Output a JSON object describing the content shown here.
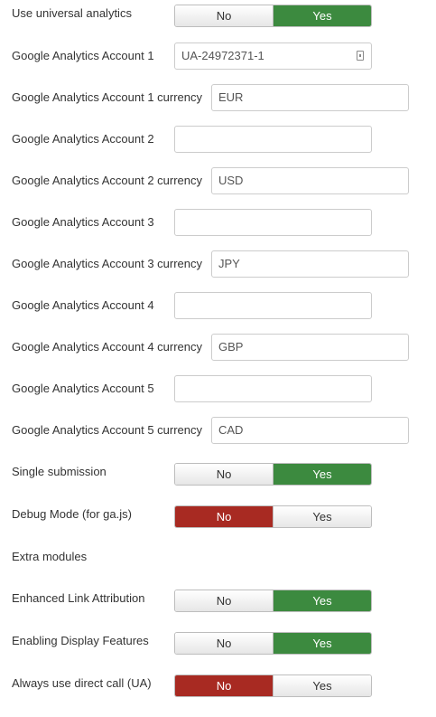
{
  "universal_analytics": {
    "label": "Use universal analytics",
    "no": "No",
    "yes": "Yes",
    "selected": "yes"
  },
  "accounts": [
    {
      "label": "Google Analytics Account 1",
      "value": "UA-24972371-1",
      "currency_label": "Google Analytics Account 1 currency",
      "currency": "EUR"
    },
    {
      "label": "Google Analytics Account 2",
      "value": "",
      "currency_label": "Google Analytics Account 2 currency",
      "currency": "USD"
    },
    {
      "label": "Google Analytics Account 3",
      "value": "",
      "currency_label": "Google Analytics Account 3 currency",
      "currency": "JPY"
    },
    {
      "label": "Google Analytics Account 4",
      "value": "",
      "currency_label": "Google Analytics Account 4 currency",
      "currency": "GBP"
    },
    {
      "label": "Google Analytics Account 5",
      "value": "",
      "currency_label": "Google Analytics Account 5 currency",
      "currency": "CAD"
    }
  ],
  "single_submission": {
    "label": "Single submission",
    "no": "No",
    "yes": "Yes",
    "selected": "yes"
  },
  "debug_mode": {
    "label": "Debug Mode (for ga.js)",
    "no": "No",
    "yes": "Yes",
    "selected": "no"
  },
  "extra_modules": {
    "label": "Extra modules"
  },
  "enhanced_link": {
    "label": "Enhanced Link Attribution",
    "no": "No",
    "yes": "Yes",
    "selected": "yes"
  },
  "display_features": {
    "label": "Enabling Display Features",
    "no": "No",
    "yes": "Yes",
    "selected": "yes"
  },
  "direct_call": {
    "label": "Always use direct call (UA)",
    "no": "No",
    "yes": "Yes",
    "selected": "no"
  },
  "colors": {
    "yes_active": "#3c8a3f",
    "no_active": "#a82a22"
  },
  "icons": {
    "account_field_icon": "key-icon"
  }
}
